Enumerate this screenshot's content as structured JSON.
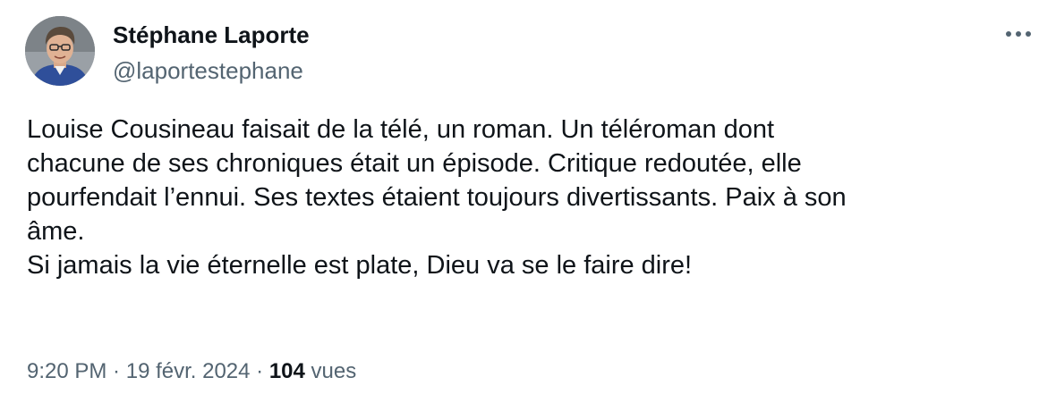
{
  "author": {
    "display_name": "Stéphane Laporte",
    "handle": "@laportestephane"
  },
  "more_button": {
    "icon": "more-horizontal-icon",
    "glyph": "•••"
  },
  "tweet": {
    "text": "Louise Cousineau faisait de la télé, un roman. Un téléroman dont\nchacune de ses chroniques était un épisode. Critique redoutée, elle\npourfendait l’ennui. Ses textes étaient toujours divertissants. Paix à son\nâme.\nSi jamais la vie éternelle est plate, Dieu va se le faire dire!"
  },
  "meta": {
    "time": "9:20 PM",
    "separator": " · ",
    "date": "19 févr. 2024",
    "views_count": "104",
    "views_label": " vues"
  },
  "colors": {
    "text_primary": "#0f1419",
    "text_secondary": "#536471",
    "background": "#ffffff"
  }
}
